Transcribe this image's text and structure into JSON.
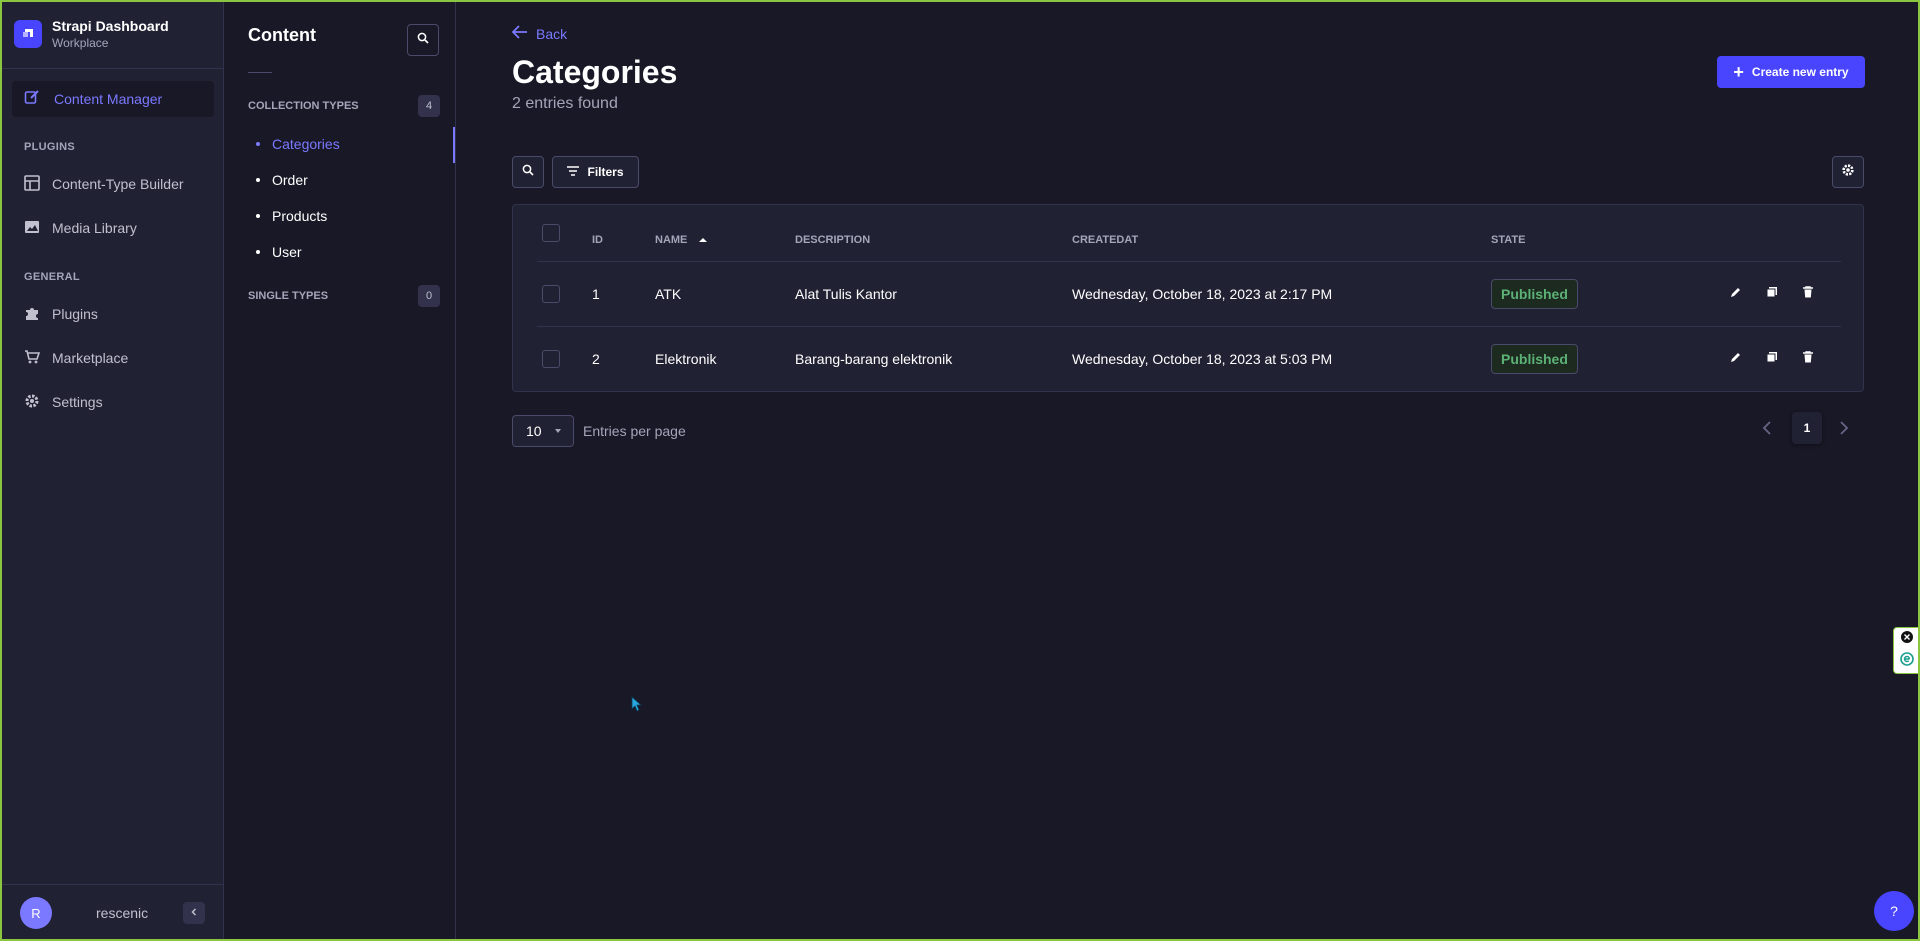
{
  "brand": {
    "title": "Strapi Dashboard",
    "subtitle": "Workplace"
  },
  "mainnav": {
    "active": "Content Manager",
    "plugins_section": "PLUGINS",
    "plugins": [
      "Content-Type Builder",
      "Media Library"
    ],
    "general_section": "GENERAL",
    "general": [
      "Plugins",
      "Marketplace",
      "Settings"
    ]
  },
  "user": {
    "initial": "R",
    "name": "rescenic"
  },
  "subnav": {
    "title": "Content",
    "collection_label": "COLLECTION TYPES",
    "collection_count": "4",
    "collection_items": [
      "Categories",
      "Order",
      "Products",
      "User"
    ],
    "single_label": "SINGLE TYPES",
    "single_count": "0"
  },
  "header": {
    "back": "Back",
    "title": "Categories",
    "subtitle": "2 entries found",
    "create": "Create new entry"
  },
  "toolbar": {
    "filters": "Filters"
  },
  "table": {
    "columns": [
      "ID",
      "NAME",
      "DESCRIPTION",
      "CREATEDAT",
      "STATE"
    ],
    "rows": [
      {
        "id": "1",
        "name": "ATK",
        "description": "Alat Tulis Kantor",
        "createdat": "Wednesday, October 18, 2023 at 2:17 PM",
        "state": "Published"
      },
      {
        "id": "2",
        "name": "Elektronik",
        "description": "Barang-barang elektronik",
        "createdat": "Wednesday, October 18, 2023 at 5:03 PM",
        "state": "Published"
      }
    ]
  },
  "pagination": {
    "per_page": "10",
    "per_page_label": "Entries per page",
    "current": "1"
  },
  "help": "?",
  "colors": {
    "accent": "#4945ff",
    "accent_text": "#7b79ff",
    "success": "#5cb176",
    "bg": "#181826",
    "panel": "#212134"
  }
}
